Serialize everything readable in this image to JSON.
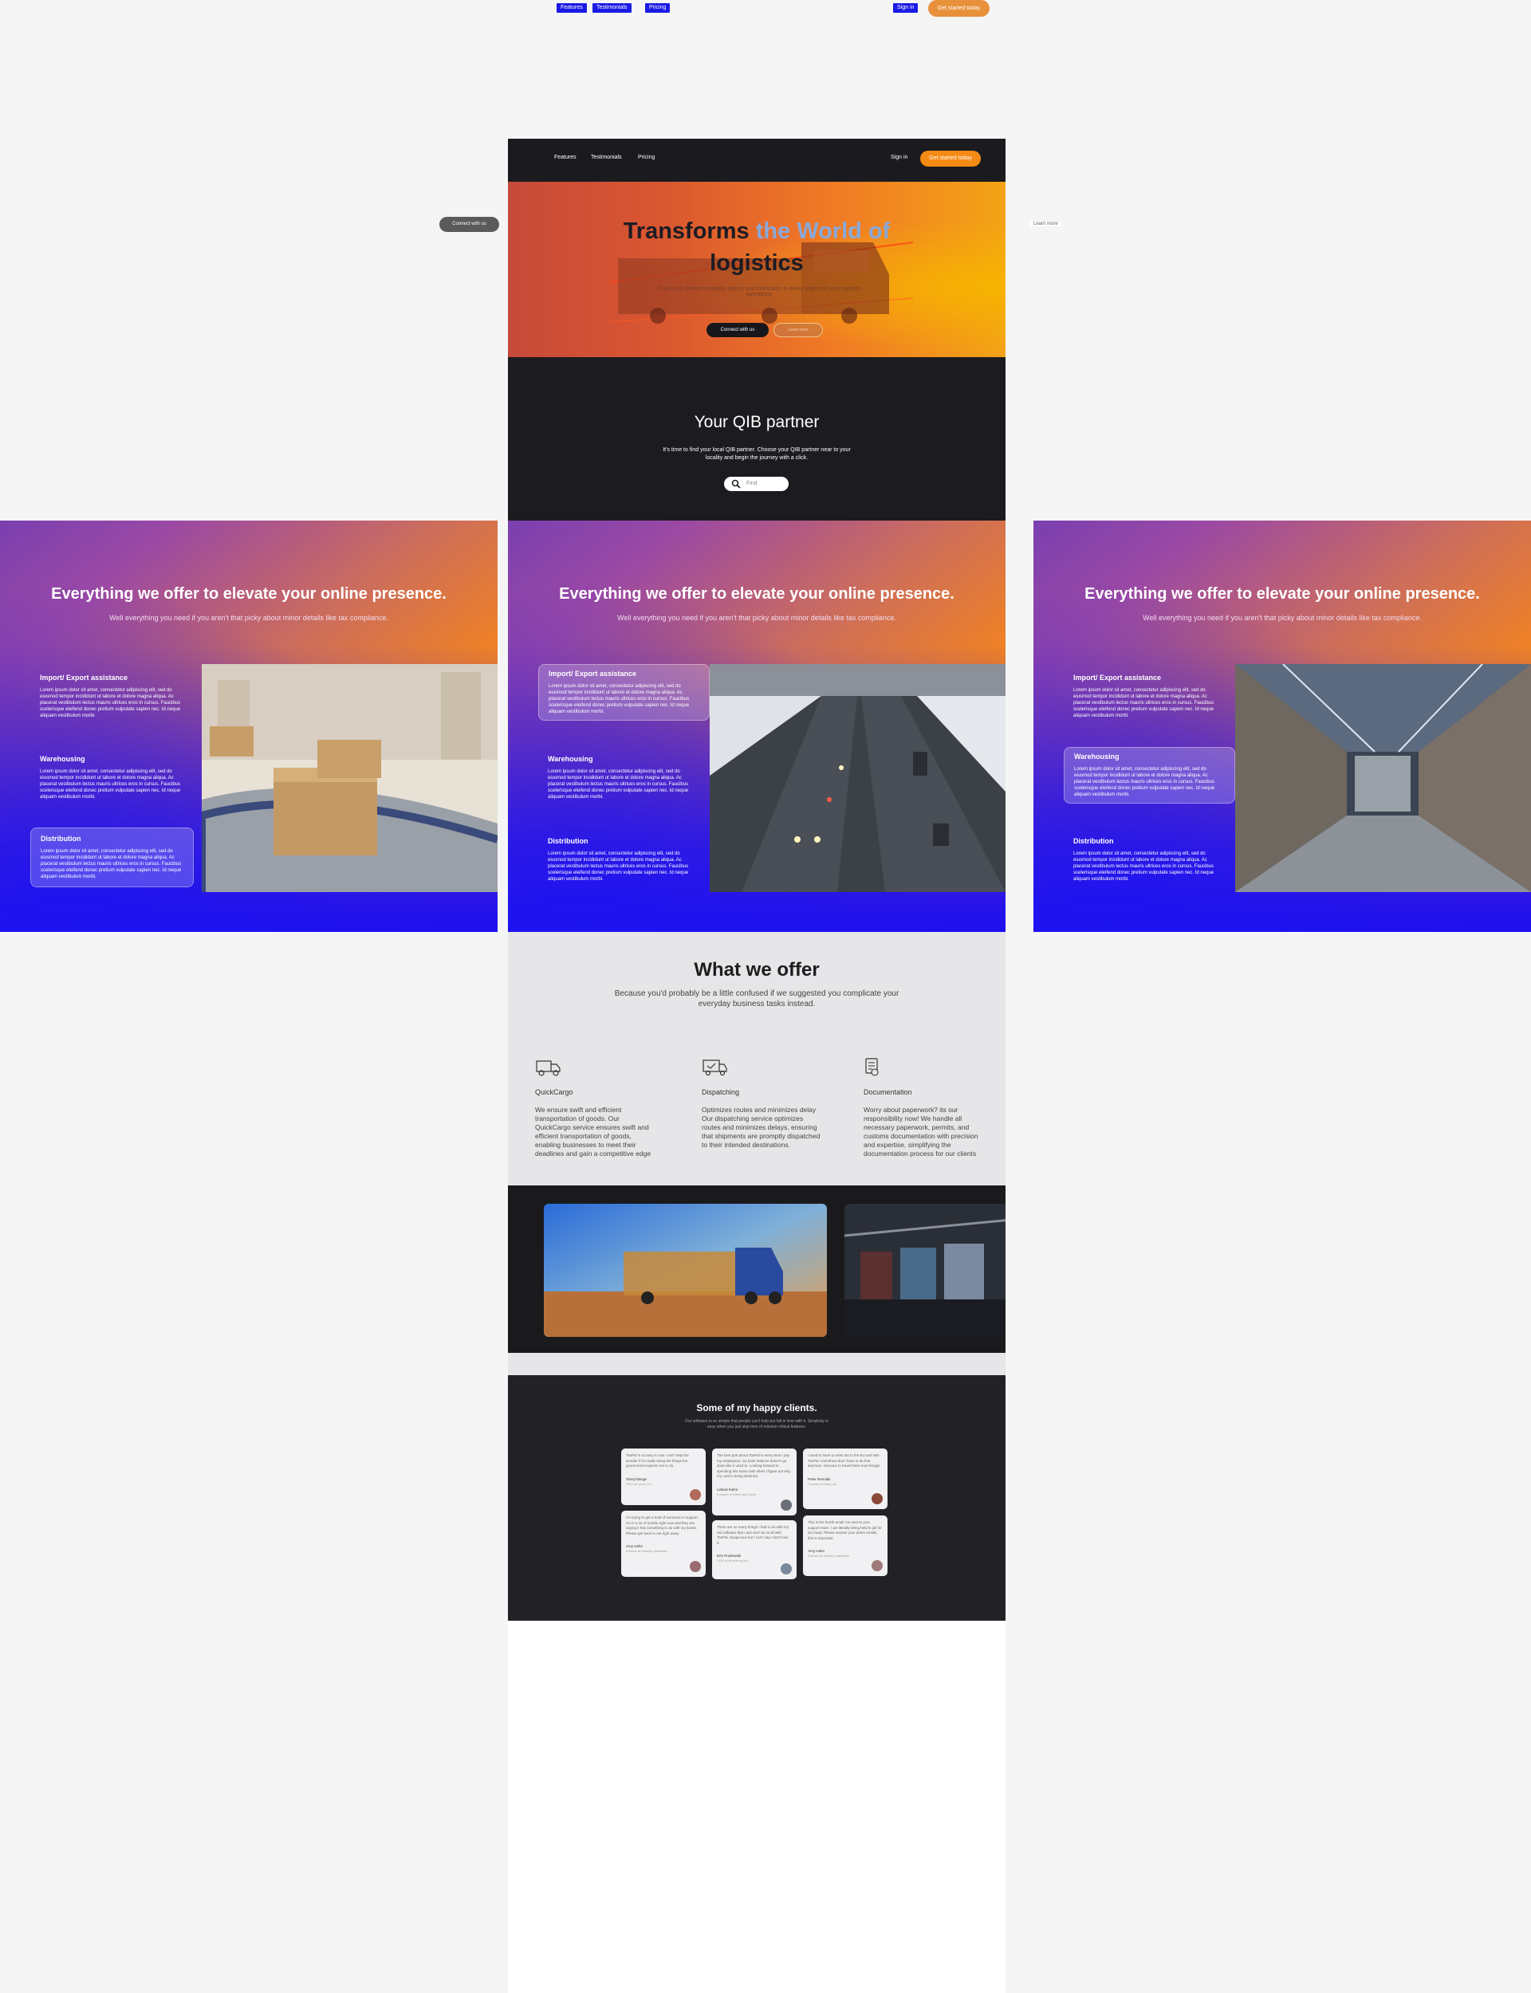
{
  "floating_nav": {
    "links": [
      "Features",
      "Testimonials",
      "Pricing"
    ],
    "sign_in": "Sign in",
    "cta": "Get started today"
  },
  "ghost": {
    "connect": "Connect with us",
    "learn": "Learn more"
  },
  "header": {
    "nav": [
      "Features",
      "Testimonials",
      "Pricing"
    ],
    "sign_in": "Sign in",
    "cta": "Get started today"
  },
  "hero": {
    "title_part1": "Transforms ",
    "title_accent": "the World of",
    "title_part2": "logistics",
    "tagline": "Trust us to deliver reliability, speed, and innovation in every aspect of your logistics operations",
    "primary_button": "Connect with us",
    "secondary_button": "Learn more"
  },
  "partner": {
    "title": "Your QIB partner",
    "text": "It's time to find your local QIB partner. Choose your QIB partner near to your locality and begin the journey with a click.",
    "search_placeholder": "Find"
  },
  "offer": {
    "title": "Everything we offer to elevate your online presence.",
    "subtitle": "Well everything you need if you aren't that picky about minor details like tax compliance.",
    "features": [
      {
        "title": "Import/ Export assistance",
        "text": "Lorem ipsum dolor sit amet, consectetur adipiscing elit, sed do eiusmod tempor incididunt ut labore et dolore magna aliqua. Ac placerat vestibulum lectus mauris ultrices eros in cursus. Faucibus scelerisque eleifend donec pretium vulputate sapien nec. Id neque aliquam vestibulum morbi."
      },
      {
        "title": "Warehousing",
        "text": "Lorem ipsum dolor sit amet, consectetur adipiscing elit, sed do eiusmod tempor incididunt ut labore et dolore magna aliqua. Ac placerat vestibulum lectus mauris ultrices eros in cursus. Faucibus scelerisque eleifend donec pretium vulputate sapien nec. Id neque aliquam vestibulum morbi."
      },
      {
        "title": "Distribution",
        "text": "Lorem ipsum dolor sit amet, consectetur adipiscing elit, sed do eiusmod tempor incididunt ut labore et dolore magna aliqua. Ac placerat vestibulum lectus mauris ultrices eros in cursus. Faucibus scelerisque eleifend donec pretium vulputate sapien nec. Id neque aliquam vestibulum morbi."
      }
    ]
  },
  "services": {
    "title": "What we offer",
    "subtitle": "Because you'd probably be a little confused if we suggested you complicate your everyday business tasks instead.",
    "items": [
      {
        "icon": "cargo-truck-icon",
        "title": "QuickCargo",
        "text": "We ensure swift and efficient transportation of goods. Our QuickCargo service ensures swift and efficient transportation of goods, enabling businesses to meet their deadlines and gain a competitive edge"
      },
      {
        "icon": "dispatch-truck-icon",
        "title": "Dispatching",
        "text": "Optimizes routes and minimizes delay Our dispatching service optimizes routes and minimizes delays, ensuring that shipments are promptly dispatched to their intended destinations."
      },
      {
        "icon": "document-icon",
        "title": "Documentation",
        "text": "Worry about paperwork? its our responsibility now! We handle all necessary paperwork, permits, and customs documentation with precision and expertise, simplifying the documentation process for our clients"
      }
    ]
  },
  "clients": {
    "title": "Some of my happy clients.",
    "subtitle": "Our software is so simple that people can't help but fall in love with it. Simplicity is easy when you just skip tons of mission-critical features.",
    "testimonials": [
      {
        "quote": "TaxPal is so easy to use I can't help but wonder if it's really doing the things the government expects me to do.",
        "name": "Sheryl Berge",
        "role": "CEO at Lynch LLC"
      },
      {
        "quote": "I'm trying to get a hold of someone in support, I'm in a lot of trouble right now and they are saying it has something to do with my books. Please get back to me right away.",
        "name": "Amy Hahn",
        "role": "Director at Velocity Industries"
      },
      {
        "quote": "The best part about TaxPal is every time I pay my employees, my bank balance doesn't go down like it used to. Looking forward to spending this extra cash when I figure out why my card is being declined.",
        "name": "Leland Kiehn",
        "role": "Founder of Kiehn and Sons"
      },
      {
        "quote": "There are so many things I had to do with my old software that I just don't do at all with TaxPal. Suspicious but I can't say I don't love it.",
        "name": "Erin Powlowski",
        "role": "COO at Armstrong Inc"
      },
      {
        "quote": "I used to have to remit tax to the EU and with TaxPal I somehow don't have to do that anymore. Nervous to travel there now though.",
        "name": "Peter Renolds",
        "role": "Founder of West Inc"
      },
      {
        "quote": "This is the fourth email I've sent to your support team. I am literally being held in jail for tax fraud. Please answer your damn emails, this is important.",
        "name": "Amy Hahn",
        "role": "Director at Velocity Industries"
      }
    ]
  }
}
